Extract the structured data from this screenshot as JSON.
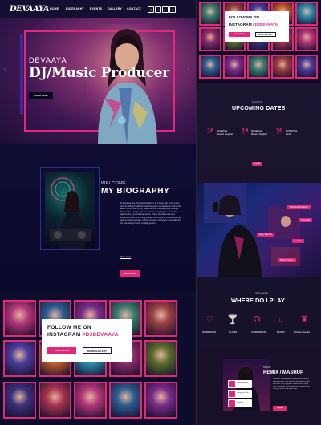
{
  "nav": {
    "logo": "DEVAAYA",
    "links": [
      "HOME",
      "BIOGRAPHY",
      "EVENTS",
      "GALLERY",
      "CONTACT"
    ],
    "social_icons": [
      "instagram-icon",
      "facebook-icon",
      "youtube-icon",
      "email-icon"
    ]
  },
  "hero": {
    "name": "DEVAAYA",
    "title": "DJ/Music Producer",
    "button": "BOOK NOW",
    "arrows": [
      "‹",
      "›"
    ]
  },
  "bio": {
    "welcome": "WELCOME",
    "heading": "MY BIOGRAPHY",
    "text": "DJ Devaaya aka Priyanka Chandrani, is a rising star in the music world & making headlines over four years of experience. Born and raised in the vibrant party capital of Goa, Devaaya was naturally drawn to the energy and vibe of music, inspiring her to turn her passion into a professional career. Today, Devaaya is a well-recognized artist performing globally and enjoying a substantial fan base in India, especially in her hometown of Goa. In a versatile DJ, she seamlessly blends multiple genres...",
    "read_more": "Show more",
    "button": "More About"
  },
  "instagram": {
    "title_line1": "FOLLOW ME ON",
    "title_line2_prefix": "INSTAGRAM",
    "handle": "#DJDEVAAYA",
    "handle_right": "#DJDEVAAYA",
    "follow_button": "FOLLOW ME",
    "gallery_button": "MORE GALLERY"
  },
  "events": {
    "label": "EVENTS",
    "heading": "UPCOMING DATES",
    "items": [
      {
        "day": "18",
        "month": "OCT",
        "line1": "Shradhas",
        "line2": "Resort Gujarat"
      },
      {
        "day": "19",
        "month": "OCT",
        "line1": "Shradhas",
        "line2": "Resort Gujarat"
      },
      {
        "day": "26",
        "month": "OCT",
        "line1": "HOSOTEL",
        "line2": "GOA"
      }
    ],
    "button": "View All"
  },
  "mix": {
    "labels": [
      "Bollywood Hits Remix",
      "Deep Tech Mix",
      "Live Mix",
      "Melodic Techno",
      "House Mix"
    ]
  },
  "services": {
    "label": "SERVICES",
    "heading": "WHERE DO I PLAY",
    "items": [
      {
        "icon": "heart-icon",
        "label": "WEDDINGS"
      },
      {
        "icon": "cocktail-icon",
        "label": "CLUBS"
      },
      {
        "icon": "corporate-icon",
        "label": "CORPORATE"
      },
      {
        "icon": "music-icon",
        "label": "MUSIC"
      },
      {
        "icon": "party-icon",
        "label": "Private Events"
      }
    ]
  },
  "remix": {
    "label": "MUSIC",
    "heading": "REMIX / MASHUP",
    "text": "Devaaya, a dedicated music producer, creates unique remixes and mashups that blend genres and styles. Her signature sound offers a fresh twist on popular tracks keeping the energy high on every dance floor and stage.",
    "button": "Explore",
    "cards": [
      "Bollywood Hits",
      "Deep Tech Mix",
      "Live Mix"
    ]
  },
  "colors": {
    "accent": "#e3287a",
    "navy": "#0c0a2e"
  }
}
